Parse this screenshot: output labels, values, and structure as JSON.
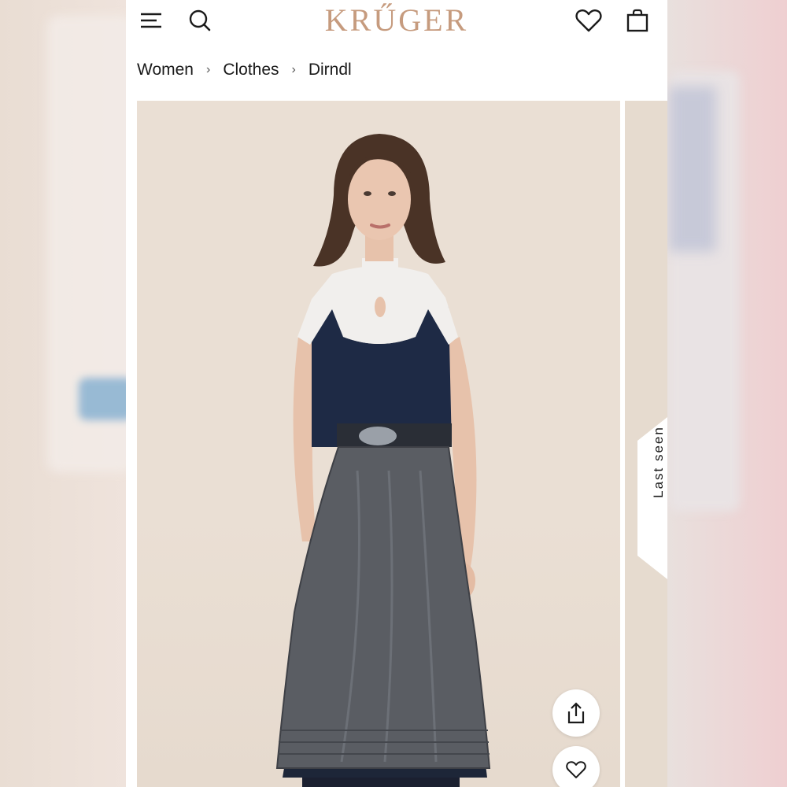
{
  "header": {
    "logo": "KRŰGER",
    "menu_icon": "hamburger-menu-icon",
    "search_icon": "search-icon",
    "wishlist_icon": "heart-icon",
    "cart_icon": "shopping-bag-icon"
  },
  "breadcrumb": {
    "items": [
      "Women",
      "Clothes",
      "Dirndl"
    ],
    "separator": "›"
  },
  "product_gallery": {
    "side_tab_label": "Last seen",
    "share_icon": "share-icon",
    "favorite_icon": "heart-icon"
  },
  "colors": {
    "brand": "#c69b7e",
    "text": "#1a1a1a",
    "photo_background": "#eadfd4",
    "dress_navy": "#1e2a45",
    "apron_grey": "#5a5d63"
  }
}
